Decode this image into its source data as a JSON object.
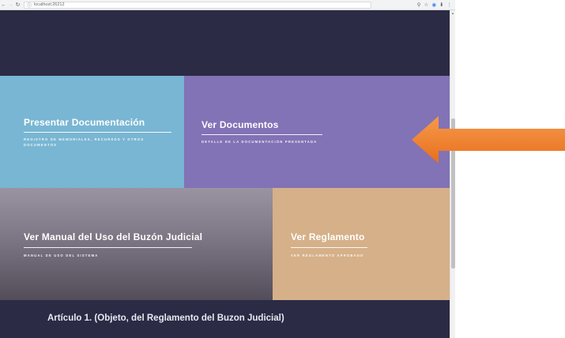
{
  "browser": {
    "back_icon": "back-arrow-icon",
    "forward_icon": "forward-arrow-icon",
    "reload_icon": "reload-icon",
    "url": "localhost:26212"
  },
  "tiles": [
    {
      "title": "Presentar Documentación",
      "subtitle": "REGISTRO DE MEMORIALES, RECURSOS Y OTROS DOCUMENTOS",
      "color": "#79b6d3"
    },
    {
      "title": "Ver Documentos",
      "subtitle": "DETALLE DE LA DOCUMENTACIÓN PRESENTADA",
      "color": "#8272b6"
    },
    {
      "title": "Ver Manual del Uso del Buzón Judicial",
      "subtitle": "MANUAL DE USO DEL SISTEMA",
      "color": "#6e6776"
    },
    {
      "title": "Ver Reglamento",
      "subtitle": "VER REGLAMENTO APROBADO",
      "color": "#d5b089"
    }
  ],
  "article": {
    "heading": "Artículo 1. (Objeto, del Reglamento del Buzon Judicial)"
  },
  "annotation": {
    "arrow_color": "#f07f2a",
    "icon": "left-arrow-annotation"
  }
}
